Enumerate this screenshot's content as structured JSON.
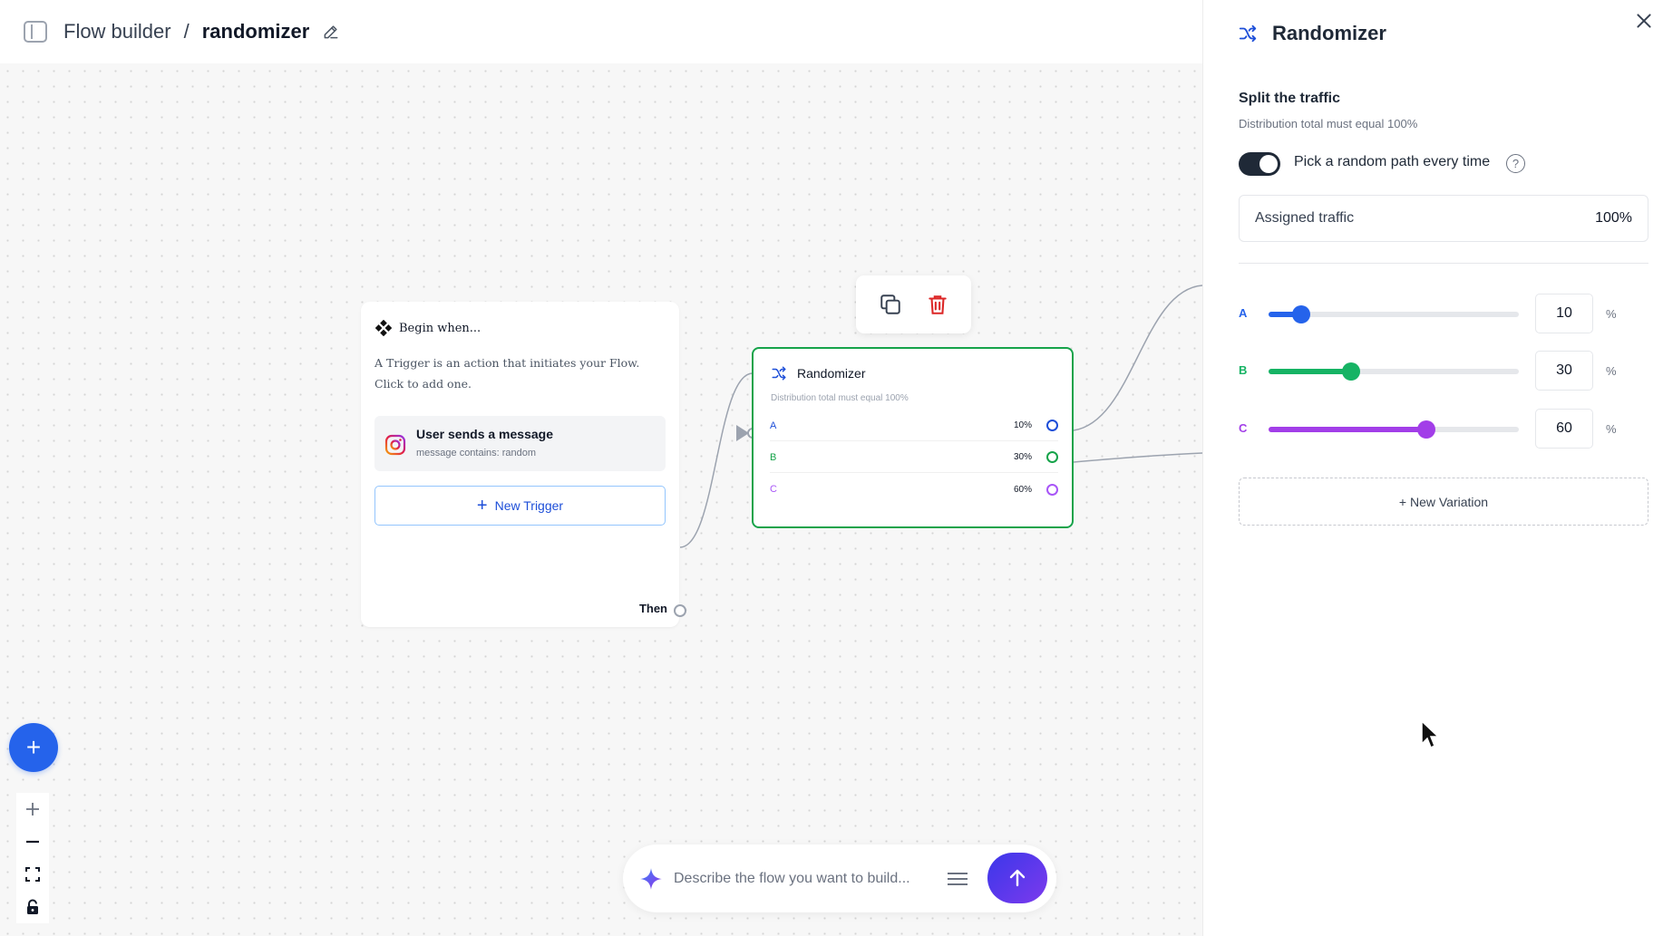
{
  "header": {
    "breadcrumb_root": "Flow builder",
    "separator": "/",
    "flow_name": "randomizer"
  },
  "trigger_node": {
    "heading": "Begin when...",
    "description": "A Trigger is an action that initiates your Flow. Click to add one.",
    "trigger": {
      "title": "User sends a message",
      "subtitle": "message contains: random",
      "icon": "instagram-icon"
    },
    "new_trigger_label": "New Trigger",
    "then_label": "Then"
  },
  "node_toolbar": {
    "icons": [
      "copy-icon",
      "trash-icon"
    ]
  },
  "randomizer_node": {
    "title": "Randomizer",
    "subtitle": "Distribution total must equal 100%",
    "rows": [
      {
        "label": "A",
        "value": "10%",
        "color": "#1d4ed8"
      },
      {
        "label": "B",
        "value": "30%",
        "color": "#16a34a"
      },
      {
        "label": "C",
        "value": "60%",
        "color": "#a855f7"
      }
    ]
  },
  "prompt": {
    "placeholder": "Describe the flow you want to build..."
  },
  "panel": {
    "title": "Randomizer",
    "section_title": "Split the traffic",
    "section_subtitle": "Distribution total must equal 100%",
    "toggle_label": "Pick a random path every time",
    "toggle_on": true,
    "help_symbol": "?",
    "assigned_label": "Assigned traffic",
    "assigned_value": "100%",
    "variations": [
      {
        "label": "A",
        "value": "10",
        "percent": 10,
        "color": "#2563eb"
      },
      {
        "label": "B",
        "value": "30",
        "percent": 30,
        "color": "#16b364"
      },
      {
        "label": "C",
        "value": "60",
        "percent": 60,
        "color": "#a23ee8"
      }
    ],
    "percent_sign": "%",
    "new_variation_label": "+ New Variation"
  },
  "colors": {
    "primary": "#2563eb",
    "node_border": "#16a34a",
    "delete": "#dc2626"
  }
}
